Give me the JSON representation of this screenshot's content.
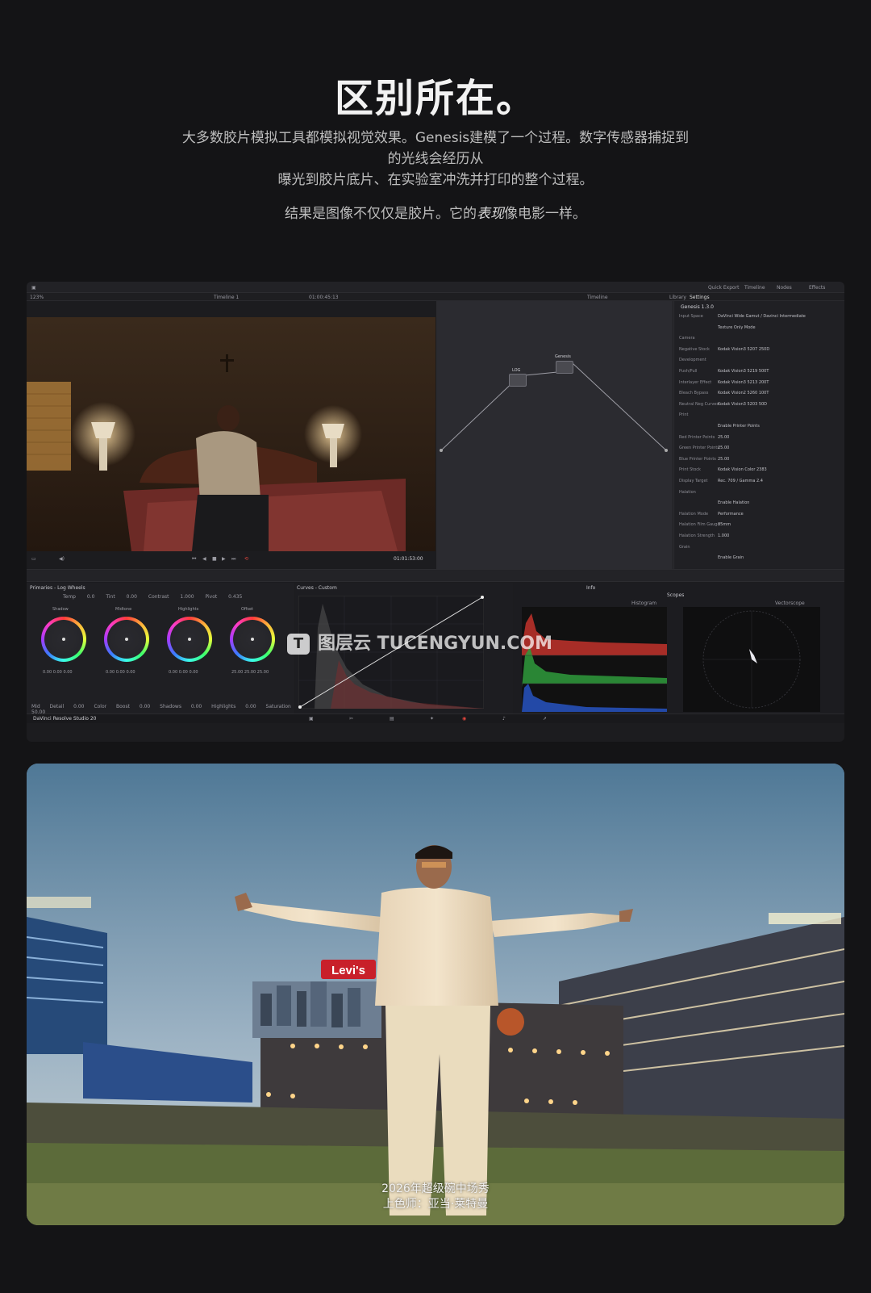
{
  "hero": {
    "title": "区别所在。",
    "line1": "大多数胶片模拟工具都模拟视觉效果。Genesis建模了一个过程。数字传感器捕捉到",
    "line2": "的光线会经历从",
    "line3": "曝光到胶片底片、在实验室冲洗并打印的整个过程。",
    "line4_a": "结果是图像不仅仅是胶片。它的",
    "line4_em": "表现",
    "line4_b": "像电影一样。"
  },
  "app": {
    "topbar": {
      "quick_export": "Quick Export",
      "timeline": "Timeline",
      "nodes": "Nodes",
      "effects": "Effects"
    },
    "subbar": {
      "zoom": "123%",
      "timeline_name": "Timeline 1",
      "timecode": "01:00:45:13",
      "timeline_label": "Timeline",
      "tab_library": "Library",
      "tab_settings": "Settings"
    },
    "transport_timecode": "01:01:53:00",
    "nodes": {
      "node1": "LOG",
      "node2": "Genesis"
    },
    "settings": {
      "plugin": "Genesis 1.3.0",
      "rows": [
        {
          "label": "Input Space",
          "value": "DaVinci Wide Gamut / Davinci Intermediate"
        },
        {
          "label": "",
          "value": "Texture Only Mode"
        },
        {
          "label": "Camera",
          "value": ""
        },
        {
          "label": "Negative Stock",
          "value": "Kodak Vision3 5207 250D"
        },
        {
          "label": "Development",
          "value": ""
        },
        {
          "label": "Push/Pull",
          "value": "Kodak Vision3 5219 500T"
        },
        {
          "label": "Interlayer Effect",
          "value": "Kodak Vision3 5213 200T"
        },
        {
          "label": "Bleach Bypass",
          "value": "Kodak Vision2 5260 100T"
        },
        {
          "label": "Neutral Neg Curves",
          "value": "Kodak Vision3 5203 50D"
        },
        {
          "label": "Print",
          "value": ""
        },
        {
          "label": "",
          "value": "Enable Printer Points"
        },
        {
          "label": "Red Printer Points",
          "value": "25.00"
        },
        {
          "label": "Green Printer Points",
          "value": "25.00"
        },
        {
          "label": "Blue Printer Points",
          "value": "25.00"
        },
        {
          "label": "Print Stock",
          "value": "Kodak Vision Color 2383"
        },
        {
          "label": "Display Target",
          "value": "Rec. 709 / Gamma 2.4"
        },
        {
          "label": "Halation",
          "value": ""
        },
        {
          "label": "",
          "value": "Enable Halation"
        },
        {
          "label": "Halation Mode",
          "value": "Performance"
        },
        {
          "label": "Halation Film Gauge",
          "value": "35mm"
        },
        {
          "label": "Halation Strength",
          "value": "1.000"
        },
        {
          "label": "Grain",
          "value": ""
        },
        {
          "label": "",
          "value": "Enable Grain"
        }
      ]
    },
    "panels": {
      "primaries": "Primaries - Log Wheels",
      "curves": "Curves - Custom",
      "info": "Info",
      "scopes": "Scopes",
      "histogram": "Histogram",
      "vectorscope": "Vectorscope"
    },
    "wheels": [
      {
        "name": "Shadow",
        "values": "0.00  0.00  0.00"
      },
      {
        "name": "Midtone",
        "values": "0.00  0.00  0.00"
      },
      {
        "name": "Highlights",
        "values": "0.00  0.00  0.00"
      },
      {
        "name": "Offset",
        "values": "25.00  25.00  25.00"
      }
    ],
    "params_top": {
      "temp": "Temp 0.0",
      "tint": "Tint 0.00",
      "contrast": "Contrast 1.000",
      "pivot": "Pivot 0.435",
      "low_range": "L.Range 0.333",
      "high_range": "H.Range 0.550"
    },
    "params_bottom": {
      "mid_detail": "Mid Detail 0.00",
      "color_boost": "Color Boost 0.00",
      "shadows": "Shadows 0.00",
      "highlights": "Highlights 0.00",
      "saturation": "Saturation 50.00",
      "hue": "Hue 50.00"
    },
    "product_name": "DaVinci Resolve Studio 20"
  },
  "watermark": {
    "text": "图层云  TUCENGYUN.COM",
    "logo": "T"
  },
  "photo": {
    "sign": "Levi's",
    "caption1": "2026年超级碗中场秀",
    "caption2": "上色师：亚当·莱特曼"
  }
}
